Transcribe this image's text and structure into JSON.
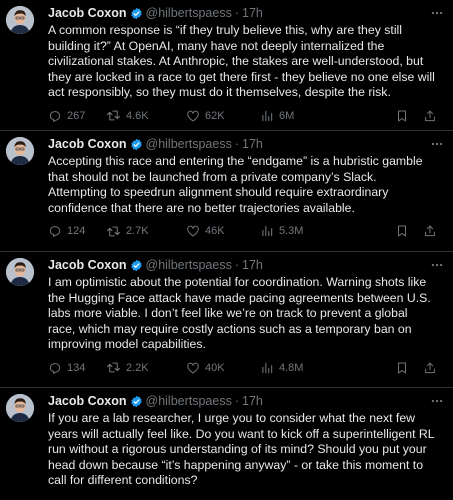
{
  "author": {
    "name": "Jacob Coxon",
    "handle": "@hilbertspaess",
    "separator": "·",
    "verified_color": "#1d9bf0"
  },
  "tweets": [
    {
      "time": "17h",
      "text": "A common response is “if they truly believe this, why are they still building it?” At OpenAI, many have not deeply internalized the civilizational stakes. At Anthropic, the stakes are well-understood, but they are locked in a race to get there first - they believe no one else will act responsibly, so they must do it themselves, despite the risk.",
      "replies": "267",
      "retweets": "4.6K",
      "likes": "62K",
      "views": "6M"
    },
    {
      "time": "17h",
      "text": "Accepting this race and entering the “endgame” is a hubristic gamble that should not be launched from a private company’s Slack. Attempting to speedrun alignment should require extraordinary confidence that there are no better trajectories available.",
      "replies": "124",
      "retweets": "2.7K",
      "likes": "46K",
      "views": "5.3M"
    },
    {
      "time": "17h",
      "text": "I am optimistic about the potential for coordination. Warning shots like the Hugging Face attack have made pacing agreements between U.S. labs more viable. I don’t feel like we’re on track to prevent a global race, which may require costly actions such as a temporary ban on improving model capabilities.",
      "replies": "134",
      "retweets": "2.2K",
      "likes": "40K",
      "views": "4.8M"
    },
    {
      "time": "17h",
      "text": "If you are a lab researcher, I urge you to consider what the next few years will actually feel like. Do you want to kick off a superintelligent RL run without a rigorous understanding of its mind? Should you put your head down because “it’s happening anyway” - or take this moment to call for different conditions?"
    }
  ],
  "icons": {
    "more": "more-horizontal-icon",
    "reply": "reply-bubble-icon",
    "retweet": "retweet-arrows-icon",
    "like": "heart-icon",
    "views": "views-bar-chart-icon",
    "bookmark": "bookmark-icon",
    "share": "share-upload-icon"
  }
}
